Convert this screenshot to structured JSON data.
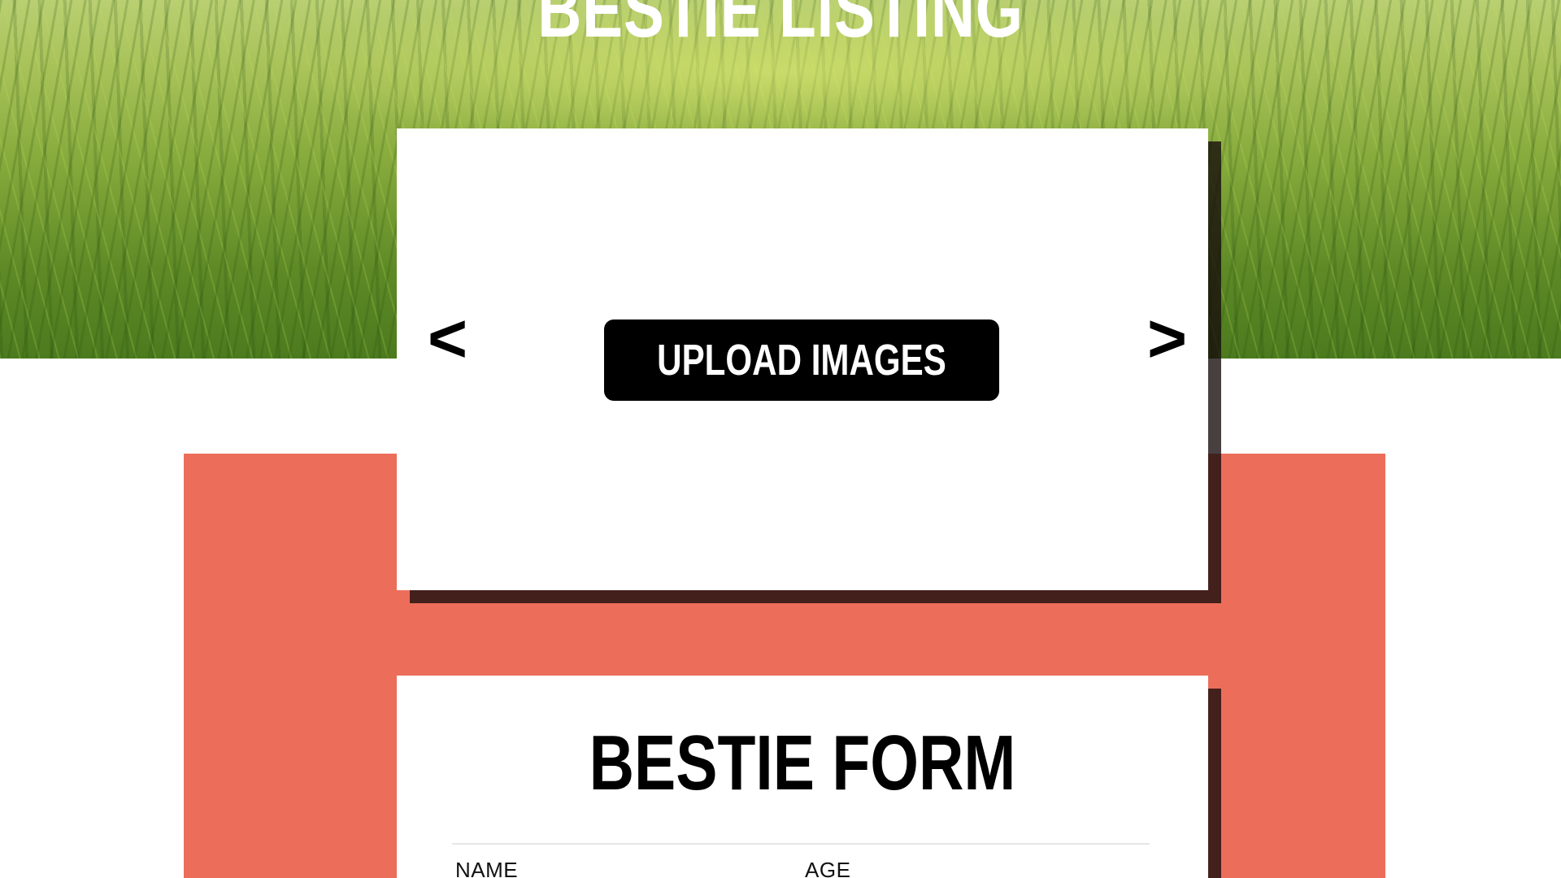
{
  "hero": {
    "title": "BESTIE LISTING"
  },
  "image_panel": {
    "prev_arrow": "<",
    "next_arrow": ">",
    "upload_label": "UPLOAD IMAGES"
  },
  "form": {
    "title": "BESTIE FORM",
    "fields": [
      {
        "label": "NAME"
      },
      {
        "label": "AGE"
      }
    ]
  },
  "colors": {
    "accent": "#ec6e5a",
    "button": "#000000",
    "card": "#ffffff"
  },
  "icons": {
    "prev": "chevron-left-icon",
    "next": "chevron-right-icon"
  }
}
